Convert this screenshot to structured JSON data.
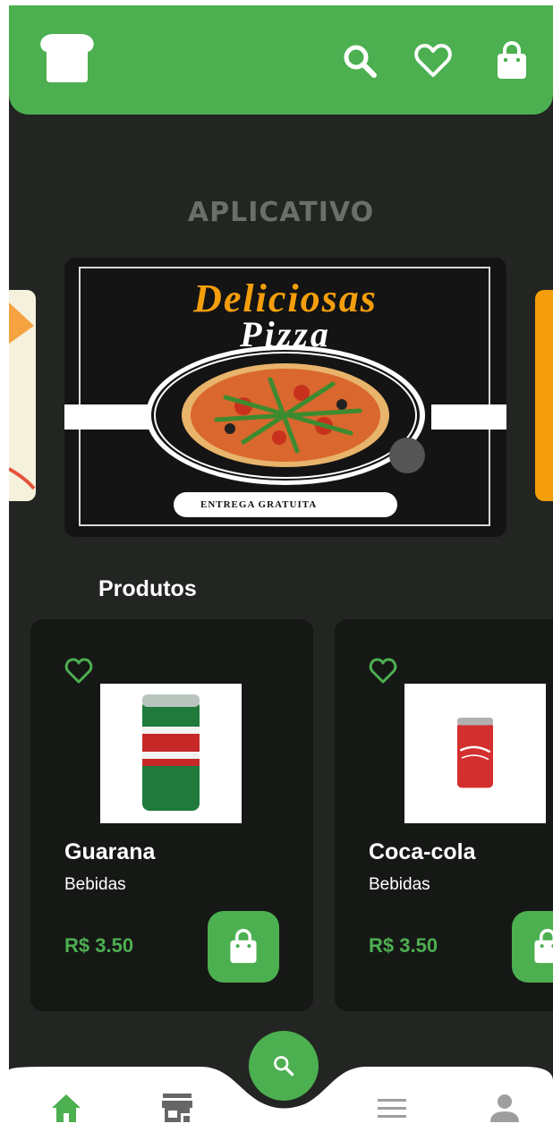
{
  "header": {
    "logo_icon": "bread-icon",
    "actions": [
      "search-icon",
      "heart-icon",
      "shopping-bag-icon"
    ],
    "color": "#4caf50"
  },
  "banner": {
    "brand_text": "APLICATIVO",
    "title_line1": "Deliciosas",
    "title_line2": "Pizza",
    "pill_text": "ENTREGA GRATUITA"
  },
  "products": {
    "section_title": "Produtos",
    "items": [
      {
        "name": "Guarana",
        "category": "Bebidas",
        "price": "R$ 3.50",
        "image": "guarana-can"
      },
      {
        "name": "Coca-cola",
        "category": "Bebidas",
        "price": "R$ 3.50",
        "image": "coca-cola-can"
      }
    ]
  },
  "bottom_nav": {
    "items": [
      "home-icon",
      "store-icon",
      "menu-icon",
      "user-icon"
    ],
    "center": "search-icon",
    "active": "home-icon"
  }
}
